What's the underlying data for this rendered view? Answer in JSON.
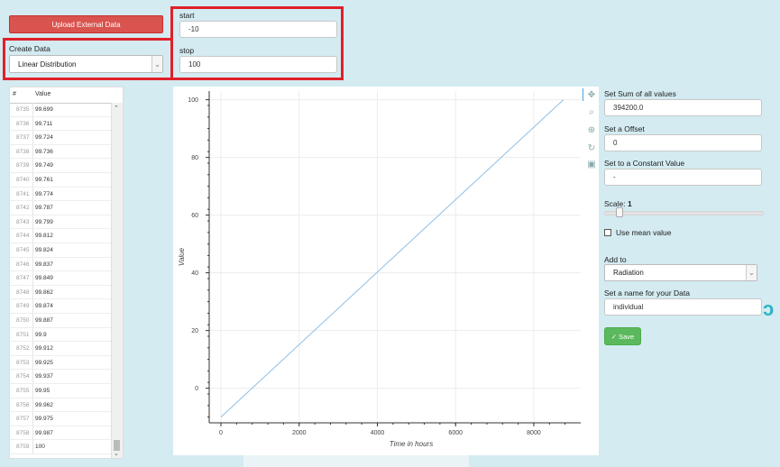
{
  "top": {
    "upload_label": "Upload External Data",
    "create_data_label": "Create Data",
    "create_data_value": "Linear Distribution",
    "start_label": "start",
    "start_value": "-10",
    "stop_label": "stop",
    "stop_value": "100"
  },
  "table": {
    "headers": [
      "#",
      "Value"
    ],
    "rows": [
      {
        "idx": "8735",
        "val": "99.699"
      },
      {
        "idx": "8736",
        "val": "99.711"
      },
      {
        "idx": "8737",
        "val": "99.724"
      },
      {
        "idx": "8738",
        "val": "99.736"
      },
      {
        "idx": "8739",
        "val": "99.749"
      },
      {
        "idx": "8740",
        "val": "99.761"
      },
      {
        "idx": "8741",
        "val": "99.774"
      },
      {
        "idx": "8742",
        "val": "99.787"
      },
      {
        "idx": "8743",
        "val": "99.799"
      },
      {
        "idx": "8744",
        "val": "99.812"
      },
      {
        "idx": "8745",
        "val": "99.824"
      },
      {
        "idx": "8746",
        "val": "99.837"
      },
      {
        "idx": "8747",
        "val": "99.849"
      },
      {
        "idx": "8748",
        "val": "99.862"
      },
      {
        "idx": "8749",
        "val": "99.874"
      },
      {
        "idx": "8750",
        "val": "99.887"
      },
      {
        "idx": "8751",
        "val": "99.9"
      },
      {
        "idx": "8752",
        "val": "99.912"
      },
      {
        "idx": "8753",
        "val": "99.925"
      },
      {
        "idx": "8754",
        "val": "99.937"
      },
      {
        "idx": "8755",
        "val": "99.95"
      },
      {
        "idx": "8756",
        "val": "99.962"
      },
      {
        "idx": "8757",
        "val": "99.975"
      },
      {
        "idx": "8758",
        "val": "99.987"
      },
      {
        "idx": "8759",
        "val": "100"
      }
    ]
  },
  "plot": {
    "xlabel": "Time in hours",
    "ylabel": "Value",
    "xticks": [
      "0",
      "2000",
      "4000",
      "6000",
      "8000"
    ],
    "yticks": [
      "0",
      "20",
      "40",
      "60",
      "80",
      "100"
    ],
    "tools": [
      "pan-icon",
      "zoom-icon",
      "wheel-zoom-icon",
      "reset-icon",
      "save-icon"
    ]
  },
  "chart_data": {
    "type": "line",
    "xlabel": "Time in hours",
    "ylabel": "Value",
    "xlim": [
      -300,
      9200
    ],
    "ylim": [
      -12,
      103
    ],
    "series": [
      {
        "x": [
          0,
          8759
        ],
        "values": [
          -10,
          100
        ]
      }
    ],
    "line_color": "#8fbfe6"
  },
  "side": {
    "sum_label": "Set Sum of all values",
    "sum_value": "394200.0",
    "offset_label": "Set a Offset",
    "offset_value": "0",
    "constant_label": "Set to a Constant Value",
    "constant_value": "-",
    "scale_label": "Scale:",
    "scale_value": "1",
    "scale_level": 0.07,
    "mean_label": "Use mean value",
    "add_to_label": "Add to",
    "add_to_value": "Radiation",
    "name_label": "Set a name for your Data",
    "name_value": "individual",
    "save_label": "✓ Save"
  }
}
